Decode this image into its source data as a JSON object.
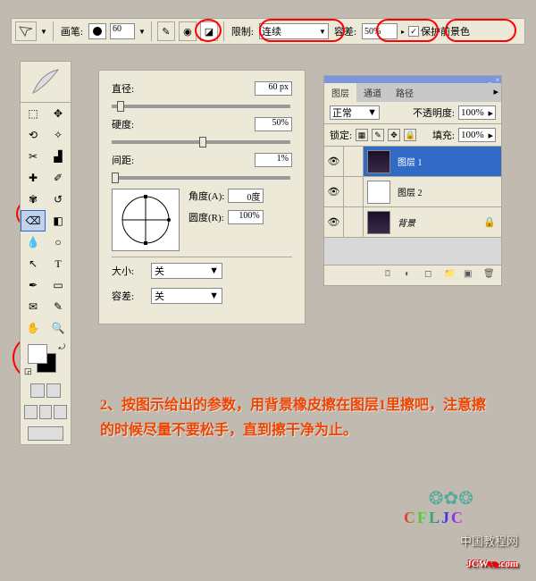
{
  "topbar": {
    "brush_label": "画笔:",
    "brush_size": "60",
    "limit_label": "限制:",
    "limit_value": "连续",
    "tolerance_label": "容差:",
    "tolerance_value": "50%",
    "protect_fg_label": "保护前景色"
  },
  "brush_panel": {
    "diameter_label": "直径:",
    "diameter_value": "60 px",
    "hardness_label": "硬度:",
    "hardness_value": "50%",
    "spacing_label": "间距:",
    "spacing_value": "1%",
    "angle_label": "角度(A):",
    "angle_value": "0度",
    "roundness_label": "圆度(R):",
    "roundness_value": "100%",
    "size_label": "大小:",
    "size_value": "关",
    "tol_label": "容差:",
    "tol_value": "关"
  },
  "layers": {
    "tabs": [
      "图层",
      "通道",
      "路径"
    ],
    "blend_value": "正常",
    "opacity_label": "不透明度:",
    "opacity_value": "100%",
    "lock_label": "锁定:",
    "fill_label": "填充:",
    "fill_value": "100%",
    "items": [
      {
        "name": "图层 1",
        "thumb": "#2a1f3a"
      },
      {
        "name": "图层 2",
        "thumb": "#ffffff"
      },
      {
        "name": "背景",
        "thumb": "#2a1f3a",
        "italic": true
      }
    ]
  },
  "instruction": "2、按图示给出的参数，用背景橡皮擦在图层1里擦吧，注意擦的时候尽量不要松手，直到擦干净为止。",
  "watermark": {
    "cn": "中国教程网",
    "en": "JCWcn.com"
  },
  "logo": "CFLJC"
}
